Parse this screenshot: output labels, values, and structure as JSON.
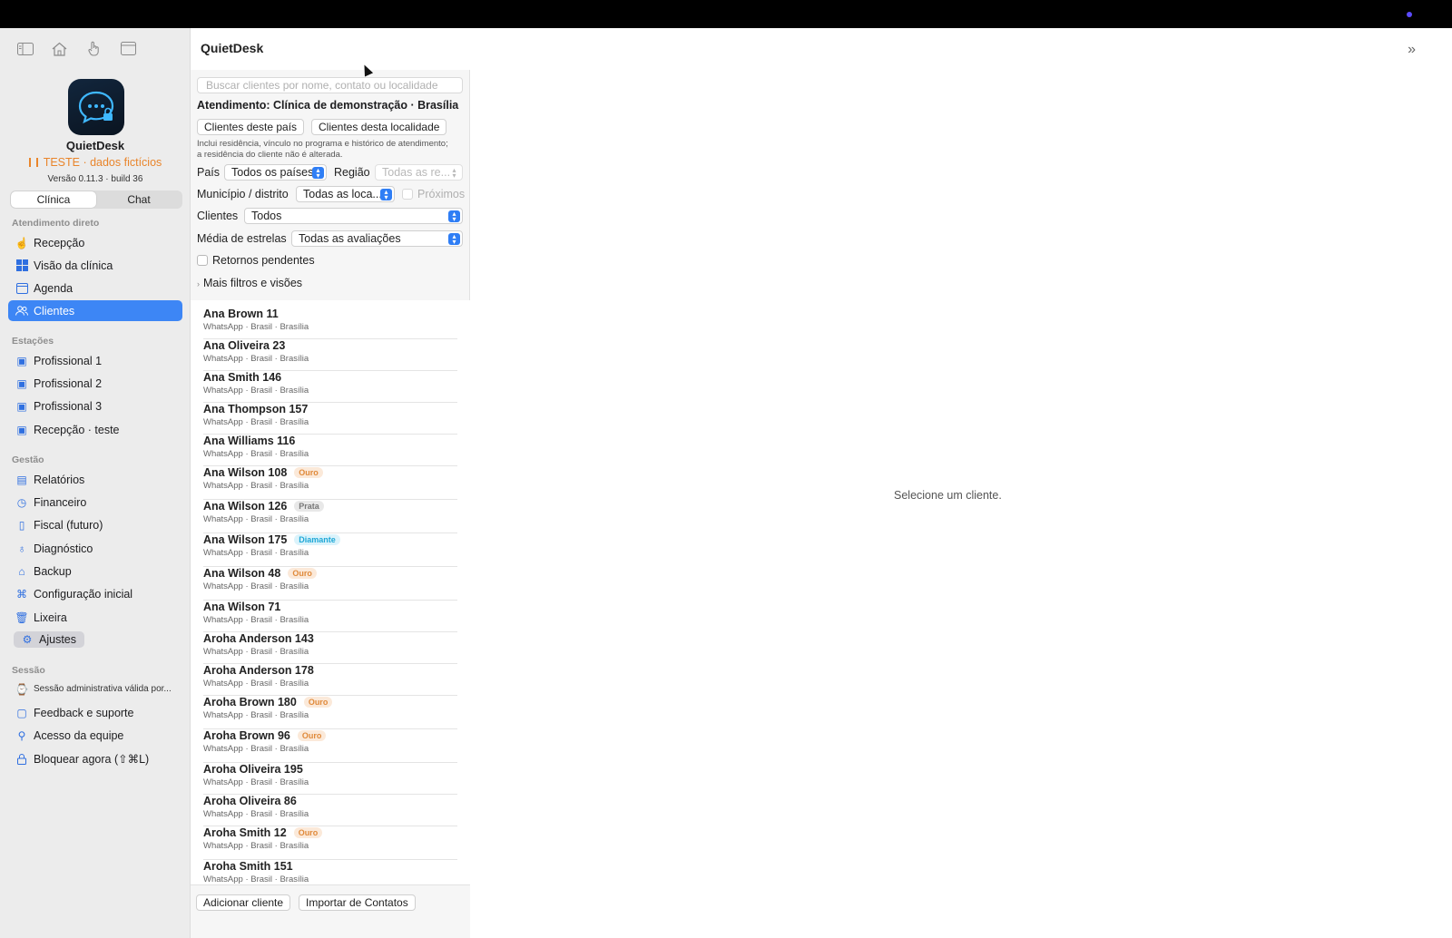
{
  "app": {
    "name": "QuietDesk",
    "test_label": "TESTE · dados fictícios",
    "version": "Versão 0.11.3 · build 36",
    "window_title": "QuietDesk"
  },
  "colors": {
    "accent": "#3d86f5",
    "test": "#e9852b",
    "ouro": "#e08a3b",
    "diamante": "#1ea7d6"
  },
  "sidebar": {
    "segments": [
      "Clínica",
      "Chat"
    ],
    "sections": [
      {
        "title": "Atendimento direto",
        "items": [
          {
            "label": "Recepção",
            "icon": "hand-point-icon"
          },
          {
            "label": "Visão da clínica",
            "icon": "grid-icon"
          },
          {
            "label": "Agenda",
            "icon": "calendar-icon"
          },
          {
            "label": "Clientes",
            "icon": "people-icon",
            "selected": true
          }
        ]
      },
      {
        "title": "Estações",
        "items": [
          {
            "label": "Profissional 1",
            "icon": "person-badge-icon"
          },
          {
            "label": "Profissional 2",
            "icon": "person-badge-icon"
          },
          {
            "label": "Profissional 3",
            "icon": "person-badge-icon"
          },
          {
            "label": "Recepção · teste",
            "icon": "person-badge-icon"
          }
        ]
      },
      {
        "title": "Gestão",
        "items": [
          {
            "label": "Relatórios",
            "icon": "document-icon"
          },
          {
            "label": "Financeiro",
            "icon": "clock-icon"
          },
          {
            "label": "Fiscal (futuro)",
            "icon": "receipt-icon"
          },
          {
            "label": "Diagnóstico",
            "icon": "stethoscope-icon"
          },
          {
            "label": "Backup",
            "icon": "drive-icon"
          },
          {
            "label": "Configuração inicial",
            "icon": "graduation-icon"
          },
          {
            "label": "Lixeira",
            "icon": "trash-icon"
          },
          {
            "label": "Ajustes",
            "icon": "gear-icon"
          }
        ]
      },
      {
        "title": "Sessão",
        "items": [
          {
            "label": "Sessão administrativa válida por...",
            "icon": "person-clock-icon"
          },
          {
            "label": "Feedback e suporte",
            "icon": "speech-bubble-icon"
          },
          {
            "label": "Acesso da equipe",
            "icon": "person-key-icon"
          },
          {
            "label": "Bloquear agora (⇧⌘L)",
            "icon": "lock-icon"
          }
        ]
      }
    ]
  },
  "filters": {
    "search_placeholder": "Buscar clientes por nome, contato ou localidade",
    "attendance_title": "Atendimento: Clínica de demonstração · Brasília",
    "btn_country": "Clientes deste país",
    "btn_locality": "Clientes desta localidade",
    "note_line1": "Inclui residência, vínculo no programa e histórico de atendimento;",
    "note_line2": "a residência do cliente não é alterada.",
    "country_label": "País",
    "country_value": "Todos os países",
    "region_label": "Região",
    "region_value": "Todas as re...",
    "municipality_label": "Município / distrito",
    "municipality_value": "Todas as loca...",
    "nearby_label": "Próximos",
    "clients_label": "Clientes",
    "clients_value": "Todos",
    "stars_label": "Média de estrelas",
    "stars_value": "Todas as avaliações",
    "pending_label": "Retornos pendentes",
    "more_filters": "Mais filtros e visões"
  },
  "clients": [
    {
      "name": "Ana Brown 11",
      "sub": "WhatsApp · Brasil · Brasília",
      "tag": ""
    },
    {
      "name": "Ana Oliveira 23",
      "sub": "WhatsApp · Brasil · Brasília",
      "tag": ""
    },
    {
      "name": "Ana Smith 146",
      "sub": "WhatsApp · Brasil · Brasília",
      "tag": ""
    },
    {
      "name": "Ana Thompson 157",
      "sub": "WhatsApp · Brasil · Brasília",
      "tag": ""
    },
    {
      "name": "Ana Williams 116",
      "sub": "WhatsApp · Brasil · Brasília",
      "tag": ""
    },
    {
      "name": "Ana Wilson 108",
      "sub": "WhatsApp · Brasil · Brasília",
      "tag": "Ouro"
    },
    {
      "name": "Ana Wilson 126",
      "sub": "WhatsApp · Brasil · Brasília",
      "tag": "Prata"
    },
    {
      "name": "Ana Wilson 175",
      "sub": "WhatsApp · Brasil · Brasília",
      "tag": "Diamante"
    },
    {
      "name": "Ana Wilson 48",
      "sub": "WhatsApp · Brasil · Brasília",
      "tag": "Ouro"
    },
    {
      "name": "Ana Wilson 71",
      "sub": "WhatsApp · Brasil · Brasília",
      "tag": ""
    },
    {
      "name": "Aroha Anderson 143",
      "sub": "WhatsApp · Brasil · Brasília",
      "tag": ""
    },
    {
      "name": "Aroha Anderson 178",
      "sub": "WhatsApp · Brasil · Brasília",
      "tag": ""
    },
    {
      "name": "Aroha Brown 180",
      "sub": "WhatsApp · Brasil · Brasília",
      "tag": "Ouro"
    },
    {
      "name": "Aroha Brown 96",
      "sub": "WhatsApp · Brasil · Brasília",
      "tag": "Ouro"
    },
    {
      "name": "Aroha Oliveira 195",
      "sub": "WhatsApp · Brasil · Brasília",
      "tag": ""
    },
    {
      "name": "Aroha Oliveira 86",
      "sub": "WhatsApp · Brasil · Brasília",
      "tag": ""
    },
    {
      "name": "Aroha Smith 12",
      "sub": "WhatsApp · Brasil · Brasília",
      "tag": "Ouro"
    },
    {
      "name": "Aroha Smith 151",
      "sub": "WhatsApp · Brasil · Brasília",
      "tag": ""
    }
  ],
  "footer": {
    "add_client": "Adicionar cliente",
    "import_contacts": "Importar de Contatos"
  },
  "detail": {
    "empty_message": "Selecione um cliente."
  }
}
